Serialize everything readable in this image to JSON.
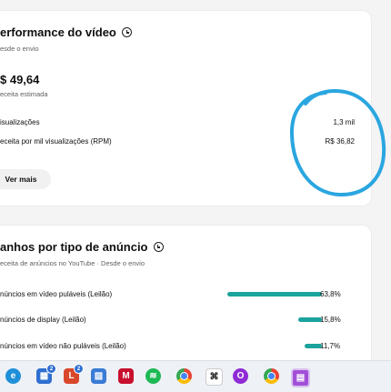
{
  "performance": {
    "title": "erformance do vídeo",
    "subtitle": "esde o envio",
    "revenue_value": "$ 49,64",
    "revenue_label": "eceita estimada",
    "rows": [
      {
        "label": "isualizações",
        "value": "1,3 mil"
      },
      {
        "label": "eceita por mil visualizações (RPM)",
        "value": "R$ 36,82"
      }
    ],
    "see_more": "Ver mais"
  },
  "ad_types": {
    "title": "anhos por tipo de anúncio",
    "subtitle": "eceita de anúncios no YouTube · Desde o envio",
    "rows": [
      {
        "label": "núncios em vídeo puláveis (Leilão)",
        "value": "63,8%",
        "fraction": 0.638
      },
      {
        "label": "núncios de display (Leilão)",
        "value": "15,8%",
        "fraction": 0.158
      },
      {
        "label": "núncios em vídeo não puláveis (Leilão)",
        "value": "11,7%",
        "fraction": 0.117
      }
    ],
    "bar_color": "#1ba39c"
  },
  "annotation": {
    "color": "#2aa6e0"
  },
  "taskbar": {
    "icons": [
      "edge-icon",
      "store-icon",
      "office-icon",
      "photos-icon",
      "mcafee-icon",
      "spotify-icon",
      "chrome-icon",
      "capcut-icon",
      "opera-icon",
      "chrome-profile-icon",
      "app-icon"
    ],
    "badges": [
      "2",
      "2"
    ]
  }
}
